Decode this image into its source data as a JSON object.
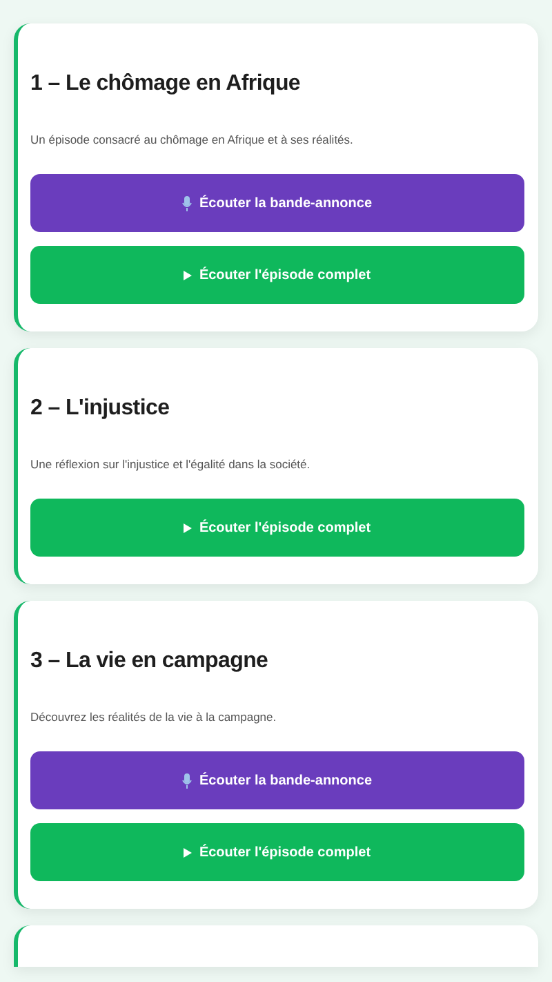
{
  "episodes": [
    {
      "title": "1 – Le chômage en Afrique",
      "description": "Un épisode consacré au chômage en Afrique et à ses réalités.",
      "buttons": [
        {
          "kind": "trailer",
          "label": "Écouter la bande-annonce"
        },
        {
          "kind": "full",
          "label": "Écouter l'épisode complet"
        }
      ]
    },
    {
      "title": "2 – L'injustice",
      "description": "Une réflexion sur l'injustice et l'égalité dans la société.",
      "buttons": [
        {
          "kind": "full",
          "label": "Écouter l'épisode complet"
        }
      ]
    },
    {
      "title": "3 – La vie en campagne",
      "description": "Découvrez les réalités de la vie à la campagne.",
      "buttons": [
        {
          "kind": "trailer",
          "label": "Écouter la bande-annonce"
        },
        {
          "kind": "full",
          "label": "Écouter l'épisode complet"
        }
      ]
    }
  ],
  "more_below": true
}
